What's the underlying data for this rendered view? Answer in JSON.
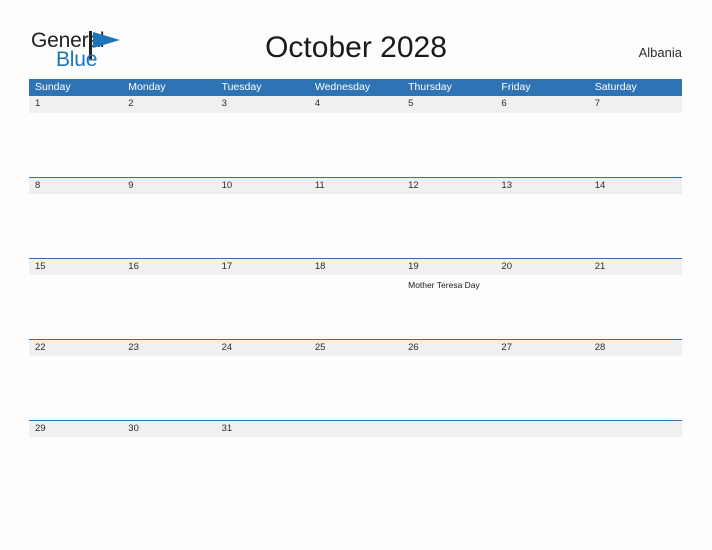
{
  "brand": {
    "word_one": "General",
    "word_two": "Blue",
    "flag_icon": "blue-flag-icon",
    "word_one_color": "#231f20",
    "word_two_color": "#1b75bb",
    "flag_color": "#1b75bb",
    "pole_color": "#231f20"
  },
  "header": {
    "title": "October 2028",
    "locale": "Albania"
  },
  "theme": {
    "header_blue": "#2e74b5",
    "date_band_gray": "#f0f0f0",
    "page_background": "#fdfdfd",
    "text_dark": "#2b2b2b"
  },
  "calendar": {
    "month": "October",
    "year": "2028",
    "country": "Albania",
    "weekdays": [
      "Sunday",
      "Monday",
      "Tuesday",
      "Wednesday",
      "Thursday",
      "Friday",
      "Saturday"
    ],
    "weeks": [
      {
        "dates": [
          "1",
          "2",
          "3",
          "4",
          "5",
          "6",
          "7"
        ],
        "events": [
          "",
          "",
          "",
          "",
          "",
          "",
          ""
        ]
      },
      {
        "dates": [
          "8",
          "9",
          "10",
          "11",
          "12",
          "13",
          "14"
        ],
        "events": [
          "",
          "",
          "",
          "",
          "",
          "",
          ""
        ]
      },
      {
        "dates": [
          "15",
          "16",
          "17",
          "18",
          "19",
          "20",
          "21"
        ],
        "events": [
          "",
          "",
          "",
          "",
          "Mother Teresa Day",
          "",
          ""
        ]
      },
      {
        "dates": [
          "22",
          "23",
          "24",
          "25",
          "26",
          "27",
          "28"
        ],
        "events": [
          "",
          "",
          "",
          "",
          "",
          "",
          ""
        ]
      },
      {
        "dates": [
          "29",
          "30",
          "31",
          "",
          "",
          "",
          ""
        ],
        "events": [
          "",
          "",
          "",
          "",
          "",
          "",
          ""
        ]
      }
    ],
    "holidays": [
      {
        "date": "19",
        "weekday": "Thursday",
        "name": "Mother Teresa Day"
      }
    ]
  }
}
